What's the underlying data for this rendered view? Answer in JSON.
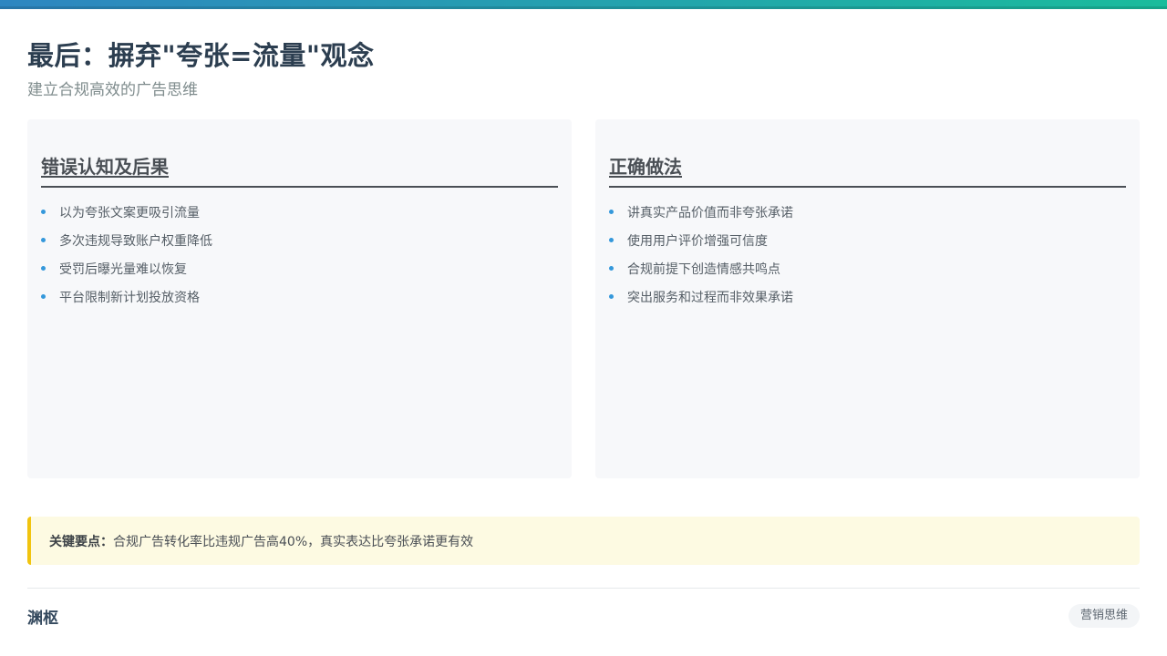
{
  "header": {
    "title": "最后：摒弃\"夸张=流量\"观念",
    "subtitle": "建立合规高效的广告思维"
  },
  "cards": {
    "wrong": {
      "heading": "错误认知及后果",
      "items": [
        "以为夸张文案更吸引流量",
        "多次违规导致账户权重降低",
        "受罚后曝光量难以恢复",
        "平台限制新计划投放资格"
      ]
    },
    "right": {
      "heading": "正确做法",
      "items": [
        "讲真实产品价值而非夸张承诺",
        "使用用户评价增强可信度",
        "合规前提下创造情感共鸣点",
        "突出服务和过程而非效果承诺"
      ]
    }
  },
  "keypoint": {
    "label": "关键要点：",
    "text": "合规广告转化率比违规广告高40%，真实表达比夸张承诺更有效"
  },
  "footer": {
    "brand": "渊枢",
    "tag": "营销思维"
  },
  "colors": {
    "accent": "#2e86c1",
    "accent2": "#1abc9c",
    "bullet": "#3498db",
    "keypoint_border": "#f1c40f",
    "keypoint_bg": "#fdfae2"
  }
}
